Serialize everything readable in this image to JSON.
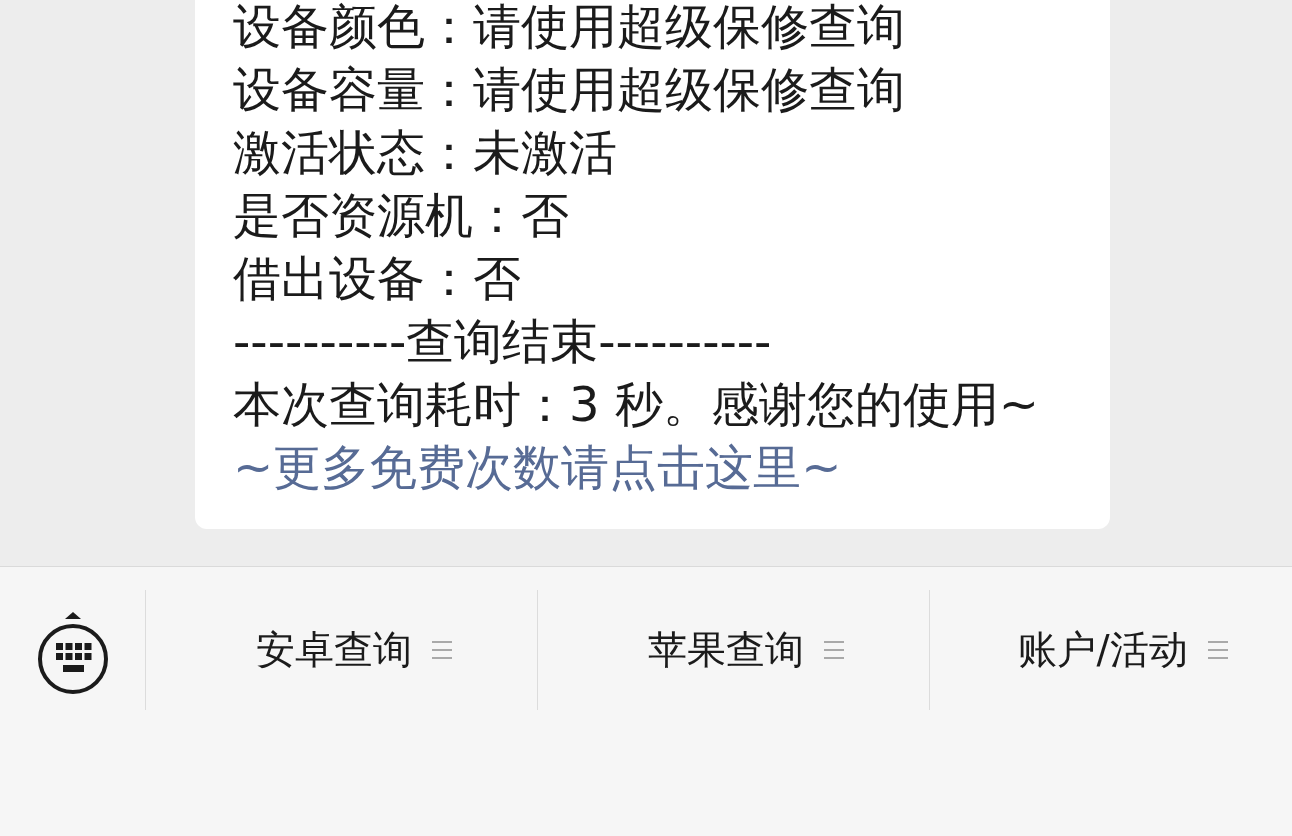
{
  "message": {
    "lines": [
      "设备颜色：请使用超级保修查询",
      "设备容量：请使用超级保修查询",
      "激活状态：未激活",
      "是否资源机：否",
      "借出设备：否",
      "----------查询结束----------",
      "本次查询耗时：3 秒。感谢您的使用~"
    ],
    "link": "~更多免费次数请点击这里~"
  },
  "menu_bar": {
    "items": [
      {
        "label": "安卓查询"
      },
      {
        "label": "苹果查询"
      },
      {
        "label": "账户/活动"
      }
    ]
  }
}
